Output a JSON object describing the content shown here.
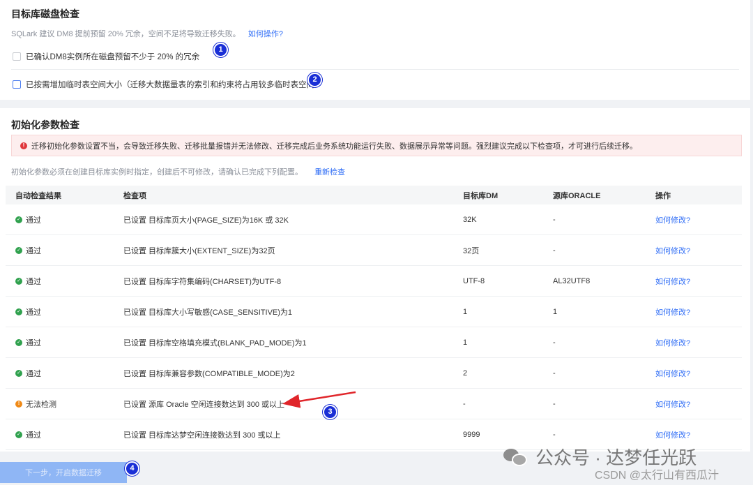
{
  "disk_check": {
    "title": "目标库磁盘检查",
    "hint": "SQLark 建议 DM8 提前预留 20% 冗余，空间不足将导致迁移失败。",
    "hint_link": "如何操作?",
    "checks": [
      {
        "label": "已确认DM8实例所在磁盘预留不少于 20% 的冗余"
      },
      {
        "label": "已按需增加临时表空间大小（迁移大数据量表的索引和约束将占用较多临时表空间）"
      }
    ]
  },
  "init_check": {
    "title": "初始化参数检查",
    "alert": "迁移初始化参数设置不当，会导致迁移失败、迁移批量报错并无法修改、迁移完成后业务系统功能运行失败、数据展示异常等问题。强烈建议完成以下检查项，才可进行后续迁移。",
    "note": "初始化参数必须在创建目标库实例时指定，创建后不可修改，请确认已完成下列配置。",
    "recheck": "重新检查",
    "table": {
      "headers": [
        "自动检查结果",
        "检查项",
        "目标库DM",
        "源库ORACLE",
        "操作"
      ],
      "rows": [
        {
          "status": "通过",
          "type": "ok",
          "item": "已设置 目标库页大小(PAGE_SIZE)为16K 或 32K",
          "dm": "32K",
          "oracle": "-",
          "action": "如何修改?"
        },
        {
          "status": "通过",
          "type": "ok",
          "item": "已设置 目标库簇大小(EXTENT_SIZE)为32页",
          "dm": "32页",
          "oracle": "-",
          "action": "如何修改?"
        },
        {
          "status": "通过",
          "type": "ok",
          "item": "已设置 目标库字符集编码(CHARSET)为UTF-8",
          "dm": "UTF-8",
          "oracle": "AL32UTF8",
          "action": "如何修改?"
        },
        {
          "status": "通过",
          "type": "ok",
          "item": "已设置 目标库大小写敏感(CASE_SENSITIVE)为1",
          "dm": "1",
          "oracle": "1",
          "action": "如何修改?"
        },
        {
          "status": "通过",
          "type": "ok",
          "item": "已设置 目标库空格填充模式(BLANK_PAD_MODE)为1",
          "dm": "1",
          "oracle": "-",
          "action": "如何修改?"
        },
        {
          "status": "通过",
          "type": "ok",
          "item": "已设置 目标库兼容参数(COMPATIBLE_MODE)为2",
          "dm": "2",
          "oracle": "-",
          "action": "如何修改?"
        },
        {
          "status": "无法检测",
          "type": "warn",
          "item": "已设置 源库 Oracle 空闲连接数达到 300 或以上",
          "dm": "-",
          "oracle": "-",
          "action": "如何修改?"
        },
        {
          "status": "通过",
          "type": "ok",
          "item": "已设置 目标库达梦空闲连接数达到 300 或以上",
          "dm": "9999",
          "oracle": "-",
          "action": "如何修改?"
        }
      ]
    }
  },
  "next_button": "下一步，开启数据迁移",
  "badges": [
    "1",
    "2",
    "3",
    "4"
  ],
  "watermark": {
    "text": "公众号 · 达梦任光跃",
    "credit": "CSDN @太行山有西瓜汁"
  },
  "colors": {
    "link": "#2f6df6",
    "ok": "#30a14e",
    "warn": "#f08a17",
    "alert": "#e0363b",
    "badge": "#1a2fd6",
    "arrow": "#e0252a"
  }
}
